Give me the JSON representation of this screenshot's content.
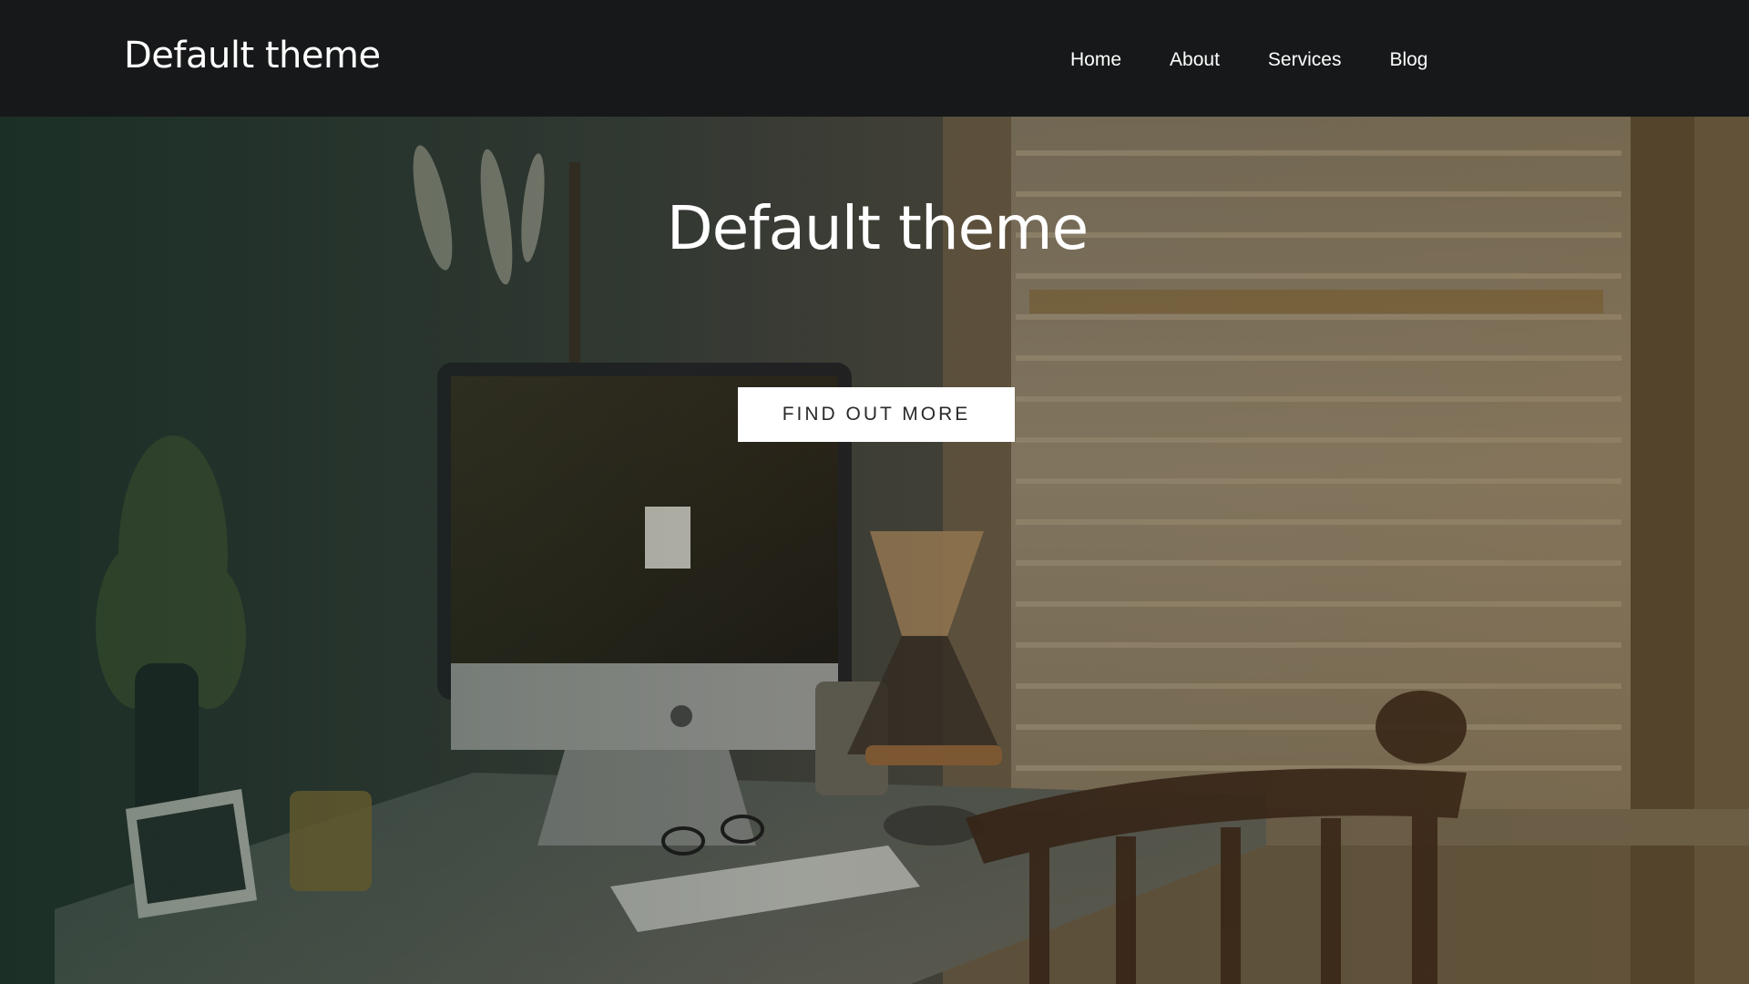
{
  "navbar": {
    "brand": "Default theme",
    "links": [
      {
        "label": "Home"
      },
      {
        "label": "About"
      },
      {
        "label": "Services"
      },
      {
        "label": "Blog"
      }
    ]
  },
  "hero": {
    "title": "Default theme",
    "cta_label": "FIND OUT MORE",
    "background_image": "desk-workspace-photo"
  },
  "colors": {
    "navbar_bg": "#161819",
    "text": "#ffffff",
    "button_bg": "#ffffff",
    "button_text": "#2a2a2a"
  }
}
